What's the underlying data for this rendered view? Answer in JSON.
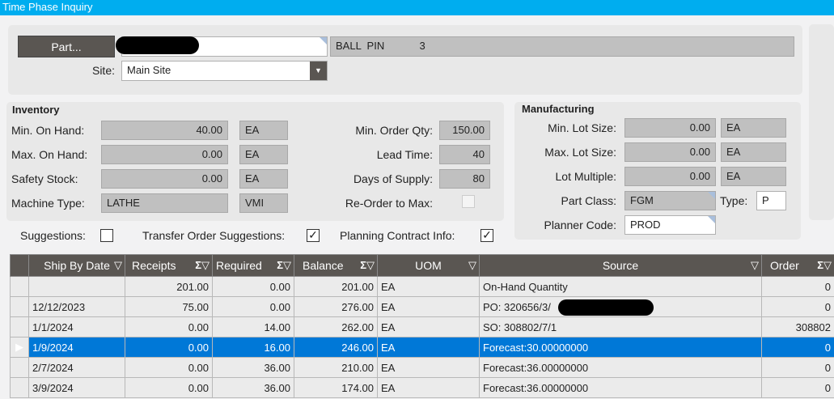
{
  "window": {
    "title": "Time Phase Inquiry"
  },
  "header": {
    "part_button": "Part...",
    "part_value": "",
    "description": "BALL  PIN            3",
    "site_label": "Site:",
    "site_value": "Main Site"
  },
  "inventory": {
    "title": "Inventory",
    "rows": [
      {
        "label": "Min. On Hand:",
        "value": "40.00",
        "unit": "EA"
      },
      {
        "label": "Max. On Hand:",
        "value": "0.00",
        "unit": "EA"
      },
      {
        "label": "Safety Stock:",
        "value": "0.00",
        "unit": "EA"
      },
      {
        "label": "Machine Type:",
        "value": "LATHE",
        "unit": "VMI"
      }
    ],
    "right": [
      {
        "label": "Min. Order Qty:",
        "value": "150.00"
      },
      {
        "label": "Lead Time:",
        "value": "40"
      },
      {
        "label": "Days of Supply:",
        "value": "80"
      }
    ],
    "reorder_label": "Re-Order to Max:",
    "reorder_checked": false
  },
  "options": {
    "suggestions_label": "Suggestions:",
    "suggestions_checked": false,
    "transfer_label": "Transfer Order Suggestions:",
    "transfer_checked": true,
    "planning_label": "Planning Contract Info:",
    "planning_checked": true
  },
  "manufacturing": {
    "title": "Manufacturing",
    "rows": [
      {
        "label": "Min. Lot Size:",
        "value": "0.00",
        "unit": "EA"
      },
      {
        "label": "Max. Lot Size:",
        "value": "0.00",
        "unit": "EA"
      },
      {
        "label": "Lot Multiple:",
        "value": "0.00",
        "unit": "EA"
      }
    ],
    "part_class_label": "Part Class:",
    "part_class": "FGM",
    "type_label": "Type:",
    "type": "P",
    "planner_label": "Planner Code:",
    "planner": "PROD"
  },
  "grid": {
    "columns": [
      "Ship By Date",
      "Receipts",
      "Required",
      "Balance",
      "UOM",
      "Source",
      "Order"
    ],
    "rows": [
      [
        "",
        "201.00",
        "0.00",
        "201.00",
        "EA",
        "On-Hand Quantity",
        "0"
      ],
      [
        "12/12/2023",
        "75.00",
        "0.00",
        "276.00",
        "EA",
        "PO: 320656/3/",
        "0"
      ],
      [
        "1/1/2024",
        "0.00",
        "14.00",
        "262.00",
        "EA",
        "SO: 308802/7/1",
        "308802"
      ],
      [
        "1/9/2024",
        "0.00",
        "16.00",
        "246.00",
        "EA",
        "Forecast:30.00000000",
        "0"
      ],
      [
        "2/7/2024",
        "0.00",
        "36.00",
        "210.00",
        "EA",
        "Forecast:36.00000000",
        "0"
      ],
      [
        "3/9/2024",
        "0.00",
        "36.00",
        "174.00",
        "EA",
        "Forecast:36.00000000",
        "0"
      ]
    ],
    "selected_row": 3
  },
  "colors": {
    "title_bar": "#00adef",
    "selected": "#0078d7",
    "header": "#5a5652"
  }
}
